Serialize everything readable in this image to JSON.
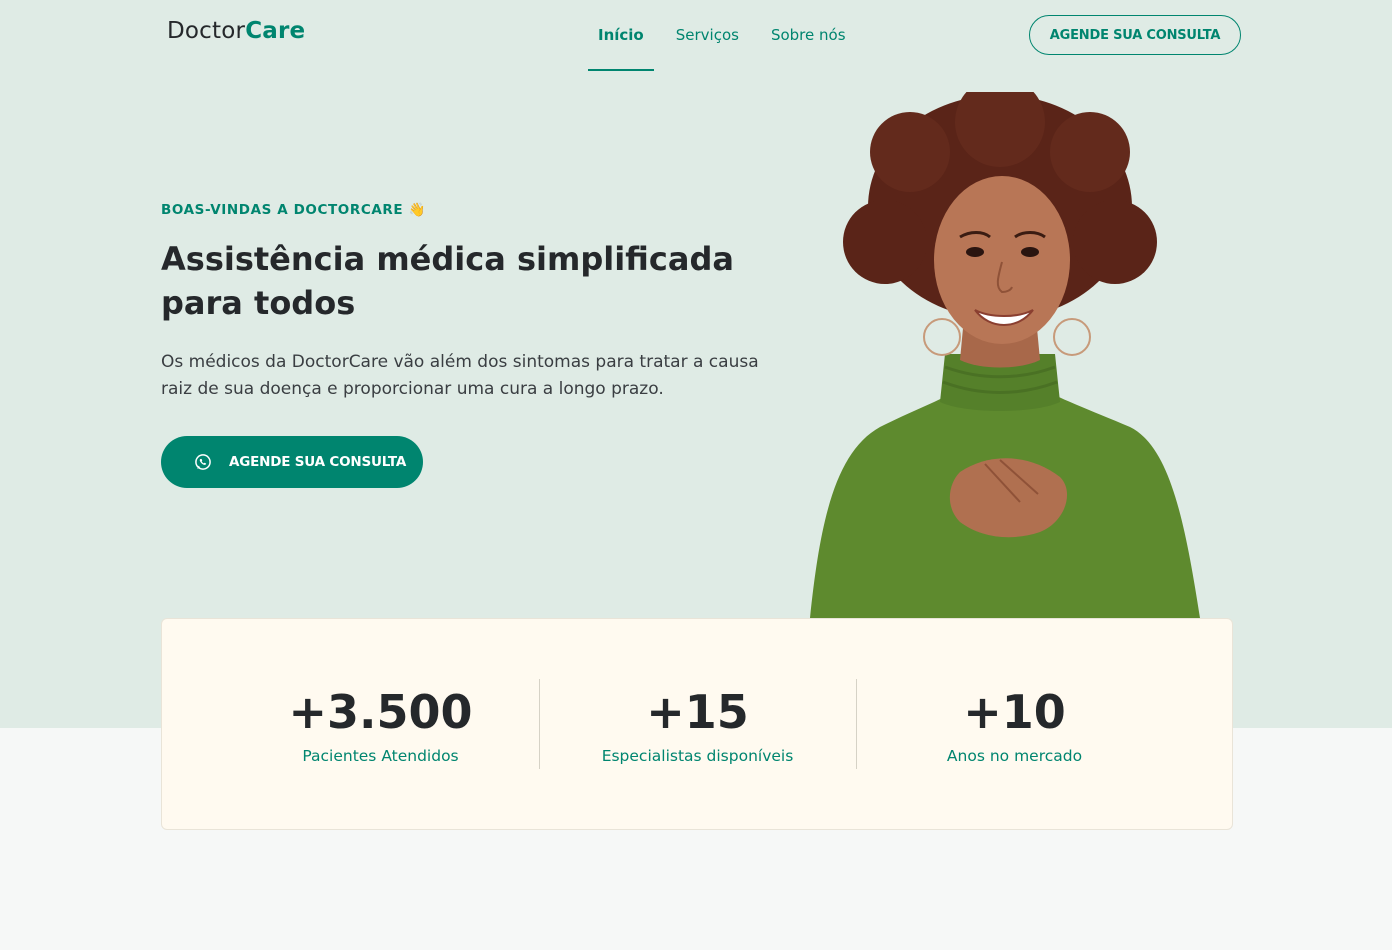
{
  "header": {
    "logo_part1": "Doctor",
    "logo_part2": "Care",
    "nav": [
      {
        "label": "Início",
        "active": true
      },
      {
        "label": "Serviços",
        "active": false
      },
      {
        "label": "Sobre nós",
        "active": false
      }
    ],
    "cta_label": "AGENDE SUA CONSULTA"
  },
  "hero": {
    "kicker": "BOAS-VINDAS A DOCTORCARE 👋",
    "title": "Assistência médica simplificada para todos",
    "description": "Os médicos da DoctorCare vão além dos sintomas para tratar a causa raiz de sua doença e proporcionar uma cura a longo prazo.",
    "cta_label": "AGENDE SUA CONSULTA",
    "cta_icon": "whatsapp-icon"
  },
  "stats": [
    {
      "value": "+3.500",
      "label": "Pacientes Atendidos"
    },
    {
      "value": "+15",
      "label": "Especialistas disponíveis"
    },
    {
      "value": "+10",
      "label": "Anos no mercado"
    }
  ],
  "colors": {
    "brand": "#00856f",
    "hero_bg": "#dfebe5",
    "stats_bg": "#fffaf0",
    "text": "#25282b"
  }
}
